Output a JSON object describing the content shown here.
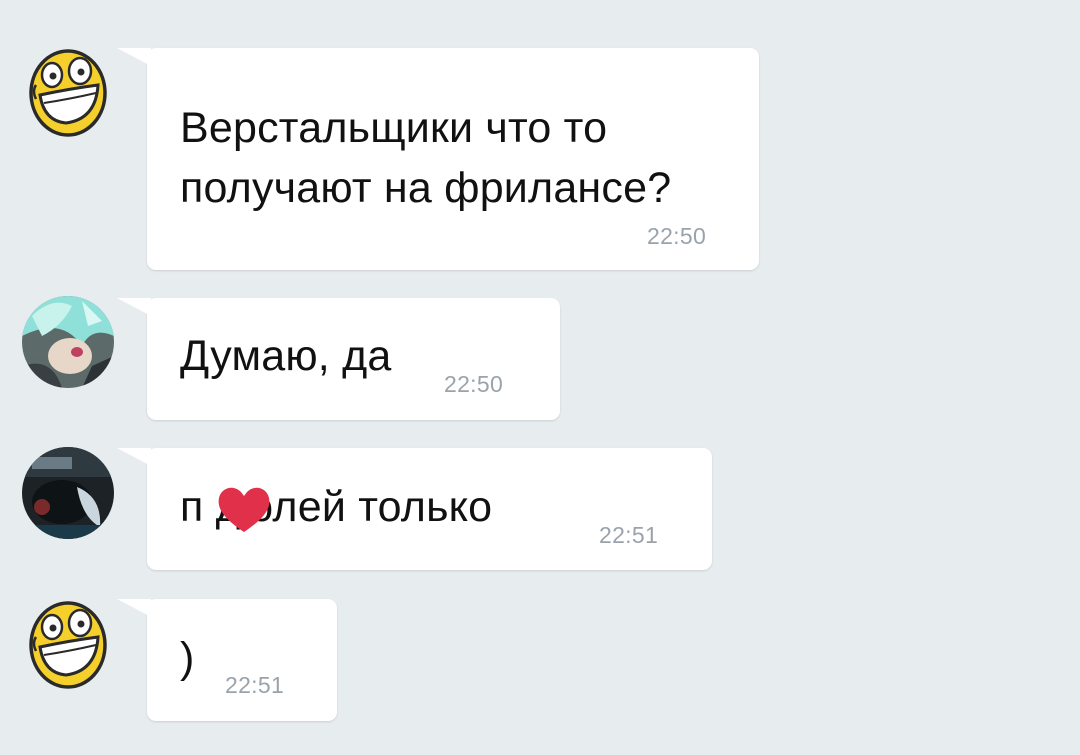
{
  "messages": [
    {
      "avatar": "grinning-yellow-face-icon",
      "text": "Верстальщики что то\nполучают на фрилансе?",
      "time": "22:50"
    },
    {
      "avatar": "cyan-haired-character-avatar",
      "text": "Думаю, да",
      "time": "22:50"
    },
    {
      "avatar": "dark-photo-avatar",
      "text": "п  дюлей только",
      "time": "22:51",
      "censored_with": "red-heart-icon"
    },
    {
      "avatar": "grinning-yellow-face-icon",
      "text": ")",
      "time": "22:51"
    }
  ],
  "colors": {
    "background": "#e7ecef",
    "bubble": "#ffffff",
    "time": "#9aa3ab",
    "heart": "#e0304a",
    "face_yellow": "#f5d02c"
  }
}
